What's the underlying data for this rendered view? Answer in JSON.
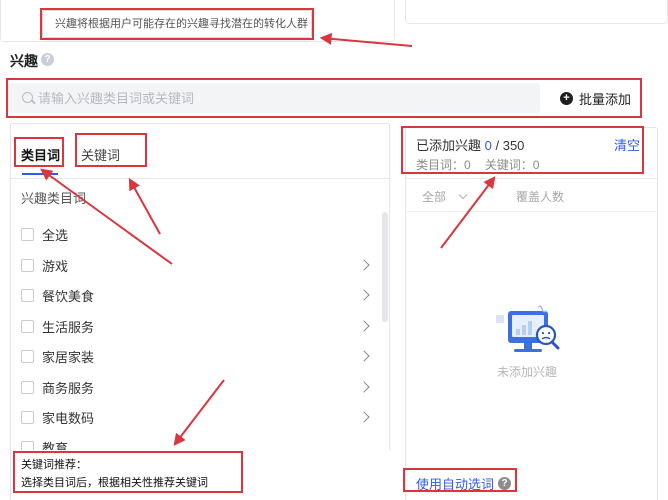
{
  "tooltip": {
    "text": "兴趣将根据用户可能存在的兴趣寻找潜在的转化人群"
  },
  "section": {
    "title": "兴趣",
    "help": "?"
  },
  "search": {
    "placeholder": "请输入兴趣类目词或关键词",
    "value": ""
  },
  "batch_add": {
    "icon": "+",
    "label": "批量添加"
  },
  "tabs": [
    {
      "label": "类目词",
      "active": true
    },
    {
      "label": "关键词",
      "active": false
    }
  ],
  "category_list": {
    "header": "兴趣类目词",
    "items": [
      "全选",
      "游戏",
      "餐饮美食",
      "生活服务",
      "家居家装",
      "商务服务",
      "家电数码",
      "教育"
    ]
  },
  "added_panel": {
    "added_label": "已添加兴趣",
    "added_count": "0",
    "max_sep": " / 350",
    "clear_label": "清空",
    "category_count_label": "类目词：0",
    "keyword_count_label": "关键词：0",
    "filter_label": "全部",
    "coverage_header": "覆盖人数",
    "empty_text": "未添加兴趣"
  },
  "keyword_recommend": {
    "title": "关键词推荐：",
    "text": "选择类目词后，根据相关性推荐关键词"
  },
  "auto_select": {
    "label": "使用自动选词",
    "help": "?"
  },
  "colors": {
    "accent": "#2f5bea",
    "annotation_red": "#d9363e",
    "search_bg": "#f3f4f6",
    "border": "#e3e5ea"
  },
  "icons": {
    "help": "help-circle-icon",
    "search": "search-icon",
    "add": "plus-circle-icon",
    "chevron_right": "chevron-right-icon",
    "chevron_down": "chevron-down-icon",
    "empty": "empty-monitor-illustration"
  }
}
